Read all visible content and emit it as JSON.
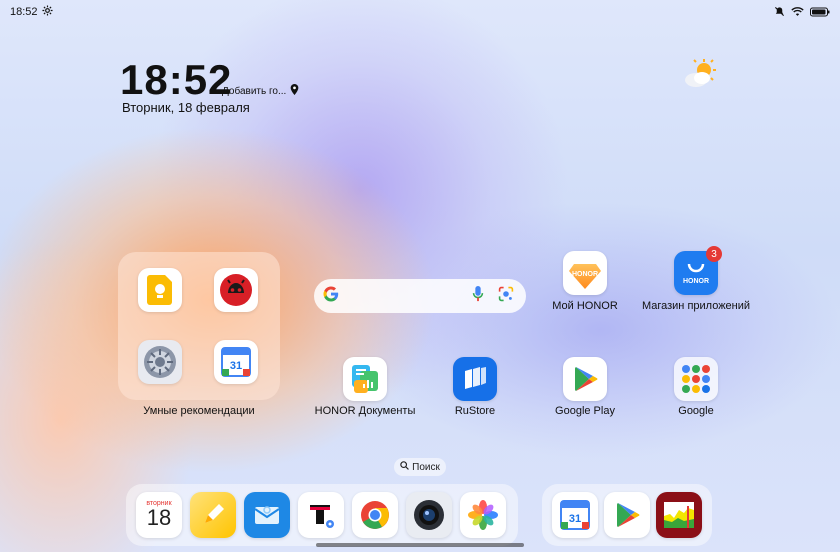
{
  "status_bar": {
    "time": "18:52"
  },
  "clock_widget": {
    "time": "18:52",
    "location": "Добавить го...",
    "date": "Вторник, 18 февраля"
  },
  "folder": {
    "label": "Умные рекомендации"
  },
  "apps": {
    "my_honor": "Мой HONOR",
    "app_store": "Магазин приложений",
    "app_store_badge": "3",
    "honor_store_text": "HONOR",
    "honor_docs": "HONOR Документы",
    "rustore": "RuStore",
    "google_play": "Google Play",
    "google": "Google"
  },
  "search_pill": {
    "label": "Поиск"
  },
  "dock": {
    "calendar_day_name": "вторник",
    "calendar_day_number": "18",
    "gcal_day": "31"
  },
  "colors": {
    "honor_blue": "#1f7cf0",
    "rustore_blue": "#1670e8",
    "accent_orange": "#ff8a3d"
  }
}
